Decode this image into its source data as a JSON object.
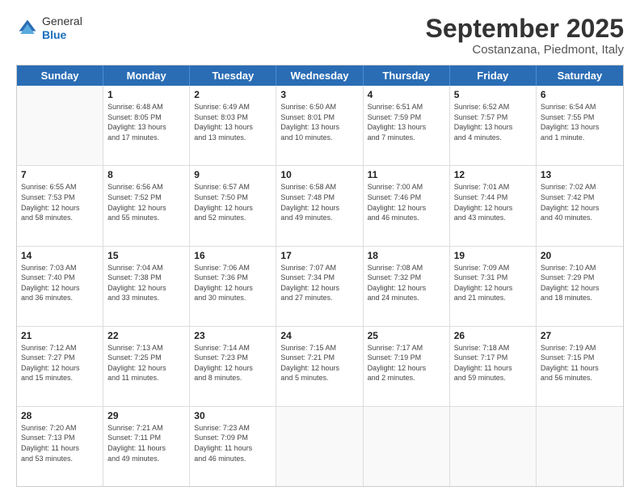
{
  "logo": {
    "general": "General",
    "blue": "Blue"
  },
  "title": "September 2025",
  "subtitle": "Costanzana, Piedmont, Italy",
  "header_days": [
    "Sunday",
    "Monday",
    "Tuesday",
    "Wednesday",
    "Thursday",
    "Friday",
    "Saturday"
  ],
  "weeks": [
    [
      {
        "day": "",
        "info": ""
      },
      {
        "day": "1",
        "info": "Sunrise: 6:48 AM\nSunset: 8:05 PM\nDaylight: 13 hours\nand 17 minutes."
      },
      {
        "day": "2",
        "info": "Sunrise: 6:49 AM\nSunset: 8:03 PM\nDaylight: 13 hours\nand 13 minutes."
      },
      {
        "day": "3",
        "info": "Sunrise: 6:50 AM\nSunset: 8:01 PM\nDaylight: 13 hours\nand 10 minutes."
      },
      {
        "day": "4",
        "info": "Sunrise: 6:51 AM\nSunset: 7:59 PM\nDaylight: 13 hours\nand 7 minutes."
      },
      {
        "day": "5",
        "info": "Sunrise: 6:52 AM\nSunset: 7:57 PM\nDaylight: 13 hours\nand 4 minutes."
      },
      {
        "day": "6",
        "info": "Sunrise: 6:54 AM\nSunset: 7:55 PM\nDaylight: 13 hours\nand 1 minute."
      }
    ],
    [
      {
        "day": "7",
        "info": "Sunrise: 6:55 AM\nSunset: 7:53 PM\nDaylight: 12 hours\nand 58 minutes."
      },
      {
        "day": "8",
        "info": "Sunrise: 6:56 AM\nSunset: 7:52 PM\nDaylight: 12 hours\nand 55 minutes."
      },
      {
        "day": "9",
        "info": "Sunrise: 6:57 AM\nSunset: 7:50 PM\nDaylight: 12 hours\nand 52 minutes."
      },
      {
        "day": "10",
        "info": "Sunrise: 6:58 AM\nSunset: 7:48 PM\nDaylight: 12 hours\nand 49 minutes."
      },
      {
        "day": "11",
        "info": "Sunrise: 7:00 AM\nSunset: 7:46 PM\nDaylight: 12 hours\nand 46 minutes."
      },
      {
        "day": "12",
        "info": "Sunrise: 7:01 AM\nSunset: 7:44 PM\nDaylight: 12 hours\nand 43 minutes."
      },
      {
        "day": "13",
        "info": "Sunrise: 7:02 AM\nSunset: 7:42 PM\nDaylight: 12 hours\nand 40 minutes."
      }
    ],
    [
      {
        "day": "14",
        "info": "Sunrise: 7:03 AM\nSunset: 7:40 PM\nDaylight: 12 hours\nand 36 minutes."
      },
      {
        "day": "15",
        "info": "Sunrise: 7:04 AM\nSunset: 7:38 PM\nDaylight: 12 hours\nand 33 minutes."
      },
      {
        "day": "16",
        "info": "Sunrise: 7:06 AM\nSunset: 7:36 PM\nDaylight: 12 hours\nand 30 minutes."
      },
      {
        "day": "17",
        "info": "Sunrise: 7:07 AM\nSunset: 7:34 PM\nDaylight: 12 hours\nand 27 minutes."
      },
      {
        "day": "18",
        "info": "Sunrise: 7:08 AM\nSunset: 7:32 PM\nDaylight: 12 hours\nand 24 minutes."
      },
      {
        "day": "19",
        "info": "Sunrise: 7:09 AM\nSunset: 7:31 PM\nDaylight: 12 hours\nand 21 minutes."
      },
      {
        "day": "20",
        "info": "Sunrise: 7:10 AM\nSunset: 7:29 PM\nDaylight: 12 hours\nand 18 minutes."
      }
    ],
    [
      {
        "day": "21",
        "info": "Sunrise: 7:12 AM\nSunset: 7:27 PM\nDaylight: 12 hours\nand 15 minutes."
      },
      {
        "day": "22",
        "info": "Sunrise: 7:13 AM\nSunset: 7:25 PM\nDaylight: 12 hours\nand 11 minutes."
      },
      {
        "day": "23",
        "info": "Sunrise: 7:14 AM\nSunset: 7:23 PM\nDaylight: 12 hours\nand 8 minutes."
      },
      {
        "day": "24",
        "info": "Sunrise: 7:15 AM\nSunset: 7:21 PM\nDaylight: 12 hours\nand 5 minutes."
      },
      {
        "day": "25",
        "info": "Sunrise: 7:17 AM\nSunset: 7:19 PM\nDaylight: 12 hours\nand 2 minutes."
      },
      {
        "day": "26",
        "info": "Sunrise: 7:18 AM\nSunset: 7:17 PM\nDaylight: 11 hours\nand 59 minutes."
      },
      {
        "day": "27",
        "info": "Sunrise: 7:19 AM\nSunset: 7:15 PM\nDaylight: 11 hours\nand 56 minutes."
      }
    ],
    [
      {
        "day": "28",
        "info": "Sunrise: 7:20 AM\nSunset: 7:13 PM\nDaylight: 11 hours\nand 53 minutes."
      },
      {
        "day": "29",
        "info": "Sunrise: 7:21 AM\nSunset: 7:11 PM\nDaylight: 11 hours\nand 49 minutes."
      },
      {
        "day": "30",
        "info": "Sunrise: 7:23 AM\nSunset: 7:09 PM\nDaylight: 11 hours\nand 46 minutes."
      },
      {
        "day": "",
        "info": ""
      },
      {
        "day": "",
        "info": ""
      },
      {
        "day": "",
        "info": ""
      },
      {
        "day": "",
        "info": ""
      }
    ]
  ]
}
